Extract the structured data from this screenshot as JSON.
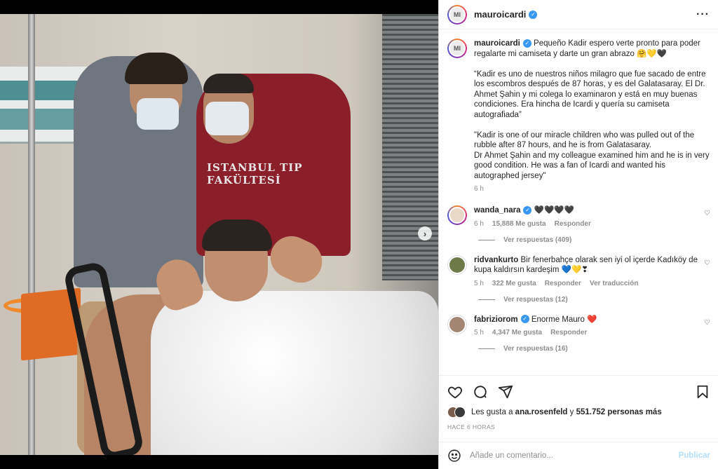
{
  "post": {
    "author": "mauroicardi",
    "avatar_initials": "MI",
    "more_icon": "more-horizontal-icon"
  },
  "photo": {
    "jersey_text": "ISTANBUL TIP\nFAKÜLTESİ",
    "next_icon": "chevron-right-icon"
  },
  "caption": {
    "username": "mauroicardi",
    "text": "Pequeño Kadir espero verte pronto para poder regalarte mi camiseta y darte un gran abrazo 🤗💛🖤\n\n“Kadir es uno de nuestros niños milagro que fue sacado de entre los escombros después de 87 horas, y es del Galatasaray. El Dr. Ahmet Şahin y mi colega lo examinaron y está en muy buenas condiciones. Era hincha de Icardi y quería su camiseta autografiada”\n\n\"Kadir is one of our miracle children who was pulled out of the rubble after 87 hours, and he is from Galatasaray.\nDr Ahmet Şahin and my colleague examined him and he is in very good condition. He was a fan of Icardi and wanted his autographed jersey\"",
    "time": "6 h"
  },
  "comments": [
    {
      "username": "wanda_nara",
      "verified": true,
      "text": "🖤🖤🖤🖤",
      "time": "6 h",
      "likes": "15,888 Me gusta",
      "reply": "Responder",
      "translate": "",
      "view_replies": "Ver respuestas (409)"
    },
    {
      "username": "ridvankurto",
      "verified": false,
      "text": "Bir fenerbahçe olarak sen iyi ol içerde Kadıköy de kupa kaldırsın kardeşim 💙💛❣",
      "time": "5 h",
      "likes": "322 Me gusta",
      "reply": "Responder",
      "translate": "Ver traducción",
      "view_replies": "Ver respuestas (12)"
    },
    {
      "username": "fabriziorom",
      "verified": true,
      "text": "Enorme Mauro ❤️",
      "time": "5 h",
      "likes": "4,347 Me gusta",
      "reply": "Responder",
      "translate": "",
      "view_replies": "Ver respuestas (16)"
    }
  ],
  "actions": {
    "like_icon": "heart-icon",
    "comment_icon": "comment-icon",
    "share_icon": "send-icon",
    "save_icon": "bookmark-icon"
  },
  "likes": {
    "prefix": "Les gusta a",
    "user": "ana.rosenfeld",
    "middle": "y",
    "others": "551.752 personas más"
  },
  "timestamp": "HACE 6 HORAS",
  "add_comment": {
    "placeholder": "Añade un comentario...",
    "publish": "Publicar",
    "emoji_icon": "emoji-icon"
  },
  "colors": {
    "verified": "#3897f0",
    "publish_disabled": "#b2dffc",
    "heart_red": "#ed4956"
  }
}
